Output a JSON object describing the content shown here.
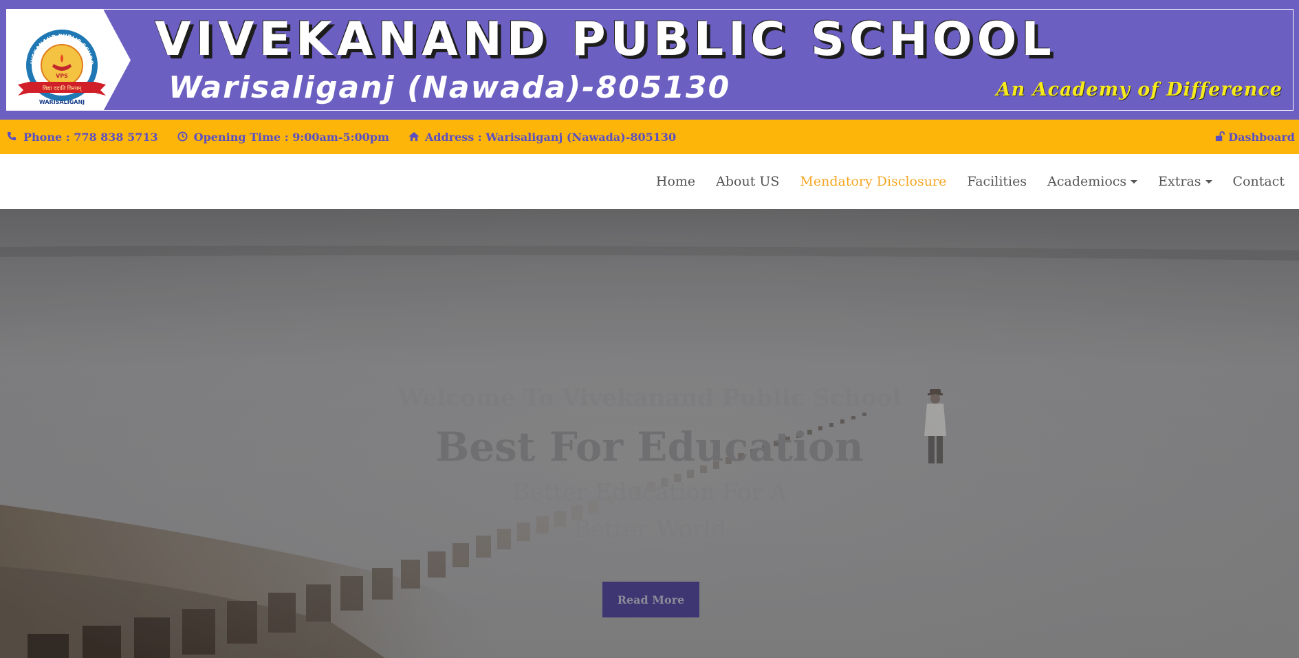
{
  "banner": {
    "school_name": "VIVEKANAND PUBLIC SCHOOL",
    "location": "Warisaliganj (Nawada)-805130",
    "tagline": "An Academy of Difference",
    "logo": {
      "ring_text": "VIVEKANAND PUBLIC SCHOOL",
      "monogram": "VPS",
      "motto": "विद्या ददाति विनयम्",
      "place": "WARISALIGANJ"
    }
  },
  "info_bar": {
    "phone": {
      "icon": "phone-icon",
      "text": "Phone : 778 838 5713"
    },
    "opening_time": {
      "icon": "clock-icon",
      "text": "Opening Time : 9:00am-5:00pm"
    },
    "address": {
      "icon": "home-icon",
      "text": "Address : Warisaliganj (Nawada)-805130"
    },
    "dashboard": {
      "icon": "unlock-icon",
      "text": "Dashboard"
    }
  },
  "nav": {
    "items": [
      {
        "label": "Home"
      },
      {
        "label": "About US"
      },
      {
        "label": "Mendatory Disclosure",
        "active": true
      },
      {
        "label": "Facilities"
      },
      {
        "label": "Academiocs",
        "dropdown": true
      },
      {
        "label": "Extras",
        "dropdown": true
      },
      {
        "label": "Contact"
      }
    ]
  },
  "hero": {
    "welcome": "Welcome To Vivekanand Public School",
    "headline": "Best For Education",
    "subheadline": "Better Education For A Better World",
    "button_label": "Read More"
  },
  "colors": {
    "banner_bg": "#6b5fc2",
    "info_bar_bg": "#fdb50a",
    "info_text": "#5a4fc2",
    "nav_text": "#555555",
    "nav_active": "#f5a623",
    "tagline": "#f7ea1c",
    "button_bg": "#3e3672"
  }
}
